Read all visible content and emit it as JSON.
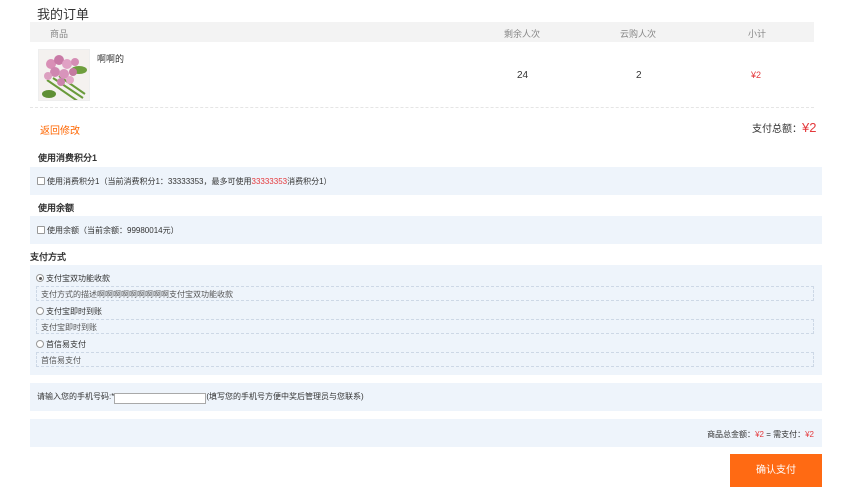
{
  "page": {
    "title": "我的订单"
  },
  "table": {
    "headers": {
      "product": "商品",
      "remaining": "剩余人次",
      "cloud_buy": "云购人次",
      "subtotal": "小计"
    },
    "rows": [
      {
        "name": "啊啊的",
        "remaining": "24",
        "cloud_buy": "2",
        "subtotal": "¥2"
      }
    ]
  },
  "actions": {
    "back_label": "返回修改",
    "confirm_label": "确认支付"
  },
  "payment_total": {
    "label": "支付总额：",
    "amount": "¥2"
  },
  "points": {
    "section_label": "使用消费积分1",
    "option_prefix": "使用消费积分1（当前消费积分1：33333353，最多可使用",
    "option_highlight": "33333353",
    "option_suffix": "消费积分1）"
  },
  "balance": {
    "section_label": "使用余额",
    "option_label": "使用余额（当前余额：99980014元）"
  },
  "payment_methods": {
    "section_label": "支付方式",
    "options": [
      {
        "label": "支付宝双功能收款",
        "description": "支付方式的描述啊啊啊啊啊啊啊啊啊支付宝双功能收款",
        "selected": true
      },
      {
        "label": "支付宝即时到账",
        "description": "支付宝即时到账",
        "selected": false
      },
      {
        "label": "首信易支付",
        "description": "首信易支付",
        "selected": false
      }
    ]
  },
  "phone": {
    "label": "请输入您的手机号码:*",
    "value": "",
    "hint": "(填写您的手机号方便中奖后管理员与您联系)"
  },
  "summary": {
    "goods_label": "商品总金额：",
    "goods_amount": "¥2",
    "separator": " = 需支付：",
    "need_amount": "¥2"
  },
  "colors": {
    "accent": "#ff6a13",
    "price": "#e4393c",
    "link": "#ff6600",
    "panel": "#eef4fb"
  }
}
